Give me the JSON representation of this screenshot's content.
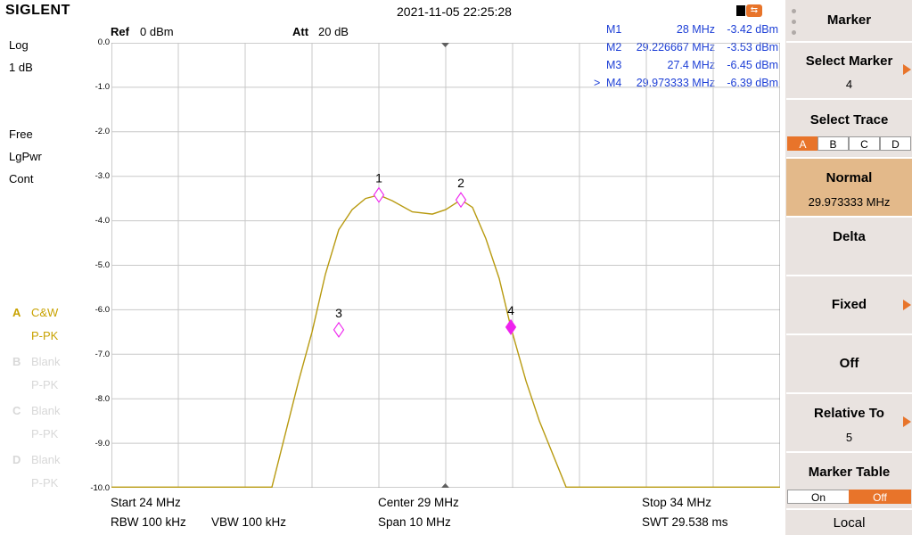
{
  "header": {
    "brand": "SIGLENT",
    "datetime": "2021-11-05 22:25:28"
  },
  "left": {
    "scale_mode": "Log",
    "scale_div": "1 dB",
    "free": "Free",
    "lgpwr": "LgPwr",
    "cont": "Cont",
    "traces": [
      {
        "letter": "A",
        "mode": "C&W",
        "det": "P-PK",
        "active": true
      },
      {
        "letter": "B",
        "mode": "Blank",
        "det": "P-PK",
        "active": false
      },
      {
        "letter": "C",
        "mode": "Blank",
        "det": "P-PK",
        "active": false
      },
      {
        "letter": "D",
        "mode": "Blank",
        "det": "P-PK",
        "active": false
      }
    ]
  },
  "top_info": {
    "ref_label": "Ref",
    "ref_value": "0 dBm",
    "att_label": "Att",
    "att_value": "20 dB"
  },
  "marker_readouts": [
    {
      "prefix": "",
      "name": "M1",
      "freq": "28 MHz",
      "level": "-3.42 dBm"
    },
    {
      "prefix": "",
      "name": "M2",
      "freq": "29.226667 MHz",
      "level": "-3.53 dBm"
    },
    {
      "prefix": "",
      "name": "M3",
      "freq": "27.4 MHz",
      "level": "-6.45 dBm"
    },
    {
      "prefix": ">",
      "name": "M4",
      "freq": "29.973333 MHz",
      "level": "-6.39 dBm"
    }
  ],
  "y_ticks": [
    "0.0",
    "-1.0",
    "-2.0",
    "-3.0",
    "-4.0",
    "-5.0",
    "-6.0",
    "-7.0",
    "-8.0",
    "-9.0",
    "-10.0"
  ],
  "footer": {
    "start": "Start  24 MHz",
    "center": "Center  29 MHz",
    "stop": "Stop  34 MHz",
    "rbw": "RBW  100 kHz",
    "vbw": "VBW  100 kHz",
    "span": "Span  10 MHz",
    "swt": "SWT  29.538 ms"
  },
  "menu": {
    "title": "Marker",
    "select_marker": {
      "label": "Select Marker",
      "value": "4"
    },
    "select_trace": {
      "label": "Select Trace",
      "options": [
        "A",
        "B",
        "C",
        "D"
      ],
      "selected": "A"
    },
    "normal": {
      "label": "Normal",
      "value": "29.973333 MHz"
    },
    "delta": {
      "label": "Delta"
    },
    "fixed": {
      "label": "Fixed"
    },
    "off": {
      "label": "Off"
    },
    "relative_to": {
      "label": "Relative To",
      "value": "5"
    },
    "marker_table": {
      "label": "Marker Table",
      "options": [
        "On",
        "Off"
      ],
      "selected": "Off"
    },
    "local": {
      "label": "Local"
    }
  },
  "chart_data": {
    "type": "line",
    "x_start_mhz": 24,
    "x_stop_mhz": 34,
    "ylim": [
      -10,
      0
    ],
    "y_unit": "dBm",
    "grid": true,
    "series": [
      {
        "color": "#b89a10",
        "x": [
          24,
          26.0,
          26.4,
          26.8,
          27.0,
          27.2,
          27.4,
          27.6,
          27.8,
          28.0,
          28.2,
          28.5,
          28.8,
          29.0,
          29.226667,
          29.4,
          29.6,
          29.8,
          29.973333,
          30.2,
          30.4,
          30.8,
          31.2,
          34
        ],
        "y": [
          -10.0,
          -10.0,
          -10.0,
          -7.6,
          -6.5,
          -5.2,
          -4.2,
          -3.75,
          -3.5,
          -3.42,
          -3.55,
          -3.8,
          -3.85,
          -3.75,
          -3.53,
          -3.7,
          -4.4,
          -5.3,
          -6.39,
          -7.6,
          -8.5,
          -10.0,
          -10.0,
          -10.0
        ]
      }
    ],
    "markers": [
      {
        "label": "1",
        "x": 28.0,
        "y": -3.42,
        "filled": false
      },
      {
        "label": "2",
        "x": 29.226667,
        "y": -3.53,
        "filled": false
      },
      {
        "label": "3",
        "x": 27.4,
        "y": -6.45,
        "filled": false
      },
      {
        "label": "4",
        "x": 29.973333,
        "y": -6.39,
        "filled": true
      }
    ]
  }
}
